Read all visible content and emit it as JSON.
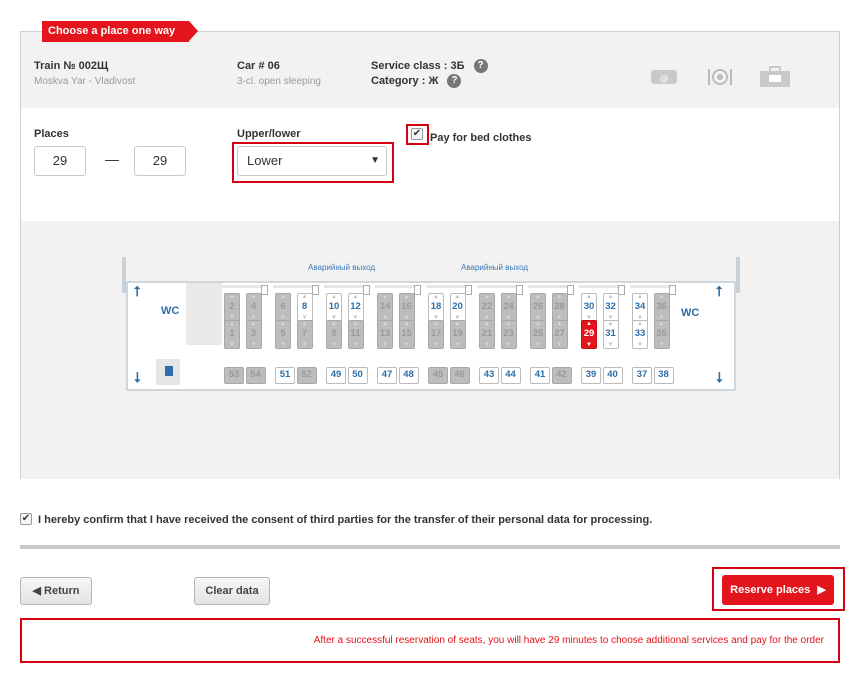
{
  "header": {
    "title": "Choose a place one way"
  },
  "train": {
    "label": "Train № 002Щ",
    "route": "Moskva Yar - Vladivost",
    "car_label": "Car # 06",
    "car_type": "3-cl. open sleeping",
    "service_class": "Service class : 3Б",
    "category": "Category : Ж"
  },
  "service_icons": [
    "email-ticket-icon",
    "meal-icon",
    "luggage-icon"
  ],
  "form": {
    "places_label": "Places",
    "place_from": "29",
    "place_to": "29",
    "dash": "—",
    "upper_lower_label": "Upper/lower",
    "upper_lower_value": "Lower",
    "bed_clothes_label": "Pay for bed clothes"
  },
  "scheme": {
    "exit_labels": [
      "Аварийный выход",
      "Аварийный выход"
    ],
    "wc_label": "WC",
    "upper_seats": [
      {
        "n": "2",
        "s": "taken"
      },
      {
        "n": "4",
        "s": "taken"
      },
      {
        "n": "6",
        "s": "taken"
      },
      {
        "n": "8",
        "s": "free"
      },
      {
        "n": "10",
        "s": "free"
      },
      {
        "n": "12",
        "s": "free"
      },
      {
        "n": "14",
        "s": "taken"
      },
      {
        "n": "16",
        "s": "taken"
      },
      {
        "n": "18",
        "s": "free"
      },
      {
        "n": "20",
        "s": "free"
      },
      {
        "n": "22",
        "s": "taken"
      },
      {
        "n": "24",
        "s": "taken"
      },
      {
        "n": "26",
        "s": "taken"
      },
      {
        "n": "28",
        "s": "taken"
      },
      {
        "n": "30",
        "s": "free"
      },
      {
        "n": "32",
        "s": "free"
      },
      {
        "n": "34",
        "s": "free"
      },
      {
        "n": "36",
        "s": "taken"
      }
    ],
    "lower_seats": [
      {
        "n": "1",
        "s": "taken"
      },
      {
        "n": "3",
        "s": "taken"
      },
      {
        "n": "5",
        "s": "taken"
      },
      {
        "n": "7",
        "s": "taken"
      },
      {
        "n": "9",
        "s": "taken"
      },
      {
        "n": "11",
        "s": "taken"
      },
      {
        "n": "13",
        "s": "taken"
      },
      {
        "n": "15",
        "s": "taken"
      },
      {
        "n": "17",
        "s": "taken"
      },
      {
        "n": "19",
        "s": "taken"
      },
      {
        "n": "21",
        "s": "taken"
      },
      {
        "n": "23",
        "s": "taken"
      },
      {
        "n": "25",
        "s": "taken"
      },
      {
        "n": "27",
        "s": "taken"
      },
      {
        "n": "29",
        "s": "selected"
      },
      {
        "n": "31",
        "s": "free"
      },
      {
        "n": "33",
        "s": "free"
      },
      {
        "n": "35",
        "s": "taken"
      }
    ],
    "side_seats": [
      {
        "n": "53",
        "s": "taken"
      },
      {
        "n": "54",
        "s": "taken"
      },
      {
        "n": "51",
        "s": "free"
      },
      {
        "n": "52",
        "s": "taken"
      },
      {
        "n": "49",
        "s": "free"
      },
      {
        "n": "50",
        "s": "free"
      },
      {
        "n": "47",
        "s": "free"
      },
      {
        "n": "48",
        "s": "free"
      },
      {
        "n": "45",
        "s": "taken"
      },
      {
        "n": "46",
        "s": "taken"
      },
      {
        "n": "43",
        "s": "free"
      },
      {
        "n": "44",
        "s": "free"
      },
      {
        "n": "41",
        "s": "free"
      },
      {
        "n": "42",
        "s": "taken"
      },
      {
        "n": "39",
        "s": "free"
      },
      {
        "n": "40",
        "s": "free"
      },
      {
        "n": "37",
        "s": "free"
      },
      {
        "n": "38",
        "s": "free"
      }
    ]
  },
  "consent_text": "I hereby confirm that I have received the consent of third parties for the transfer of their personal data for processing.",
  "buttons": {
    "return": "Return",
    "clear": "Clear data",
    "reserve": "Reserve places"
  },
  "notice": "After a successful reservation of seats, you will have 29 minutes to choose additional services and pay for the order",
  "colors": {
    "accent": "#e3141b",
    "seat_free_text": "#2c6ea8",
    "seat_taken": "#bdbdbd"
  }
}
